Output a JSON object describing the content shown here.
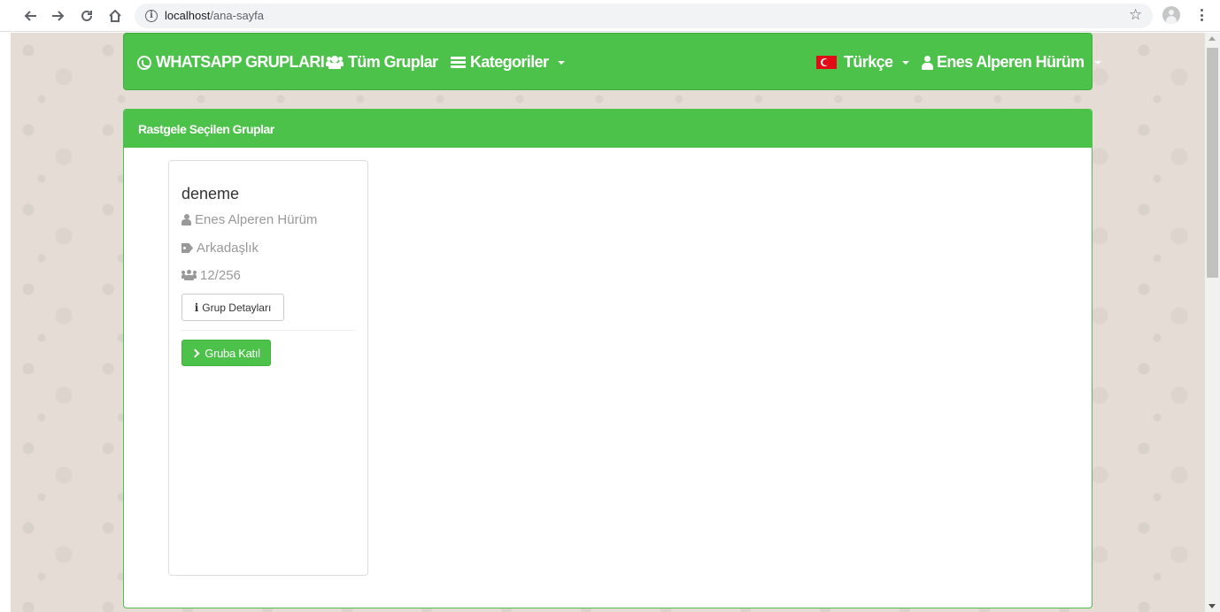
{
  "browser": {
    "url_host": "localhost",
    "url_path": "/ana-sayfa",
    "icons": [
      "back-icon",
      "forward-icon",
      "reload-icon",
      "home-icon",
      "info-icon",
      "star-icon",
      "profile-icon",
      "menu-icon"
    ]
  },
  "navbar": {
    "brand": "WHATSAPP GRUPLARI",
    "all_groups": "Tüm Gruplar",
    "categories": "Kategoriler",
    "language": "Türkçe",
    "user": "Enes Alperen Hürüm",
    "color": "#4cc24a"
  },
  "panel": {
    "heading": "Rastgele Seçilen Gruplar"
  },
  "cards": [
    {
      "title": "deneme",
      "owner": "Enes Alperen Hürüm",
      "category": "Arkadaşlık",
      "members": "12/256",
      "details_button": "Grup Detayları",
      "join_button": "Gruba Katıl"
    }
  ]
}
